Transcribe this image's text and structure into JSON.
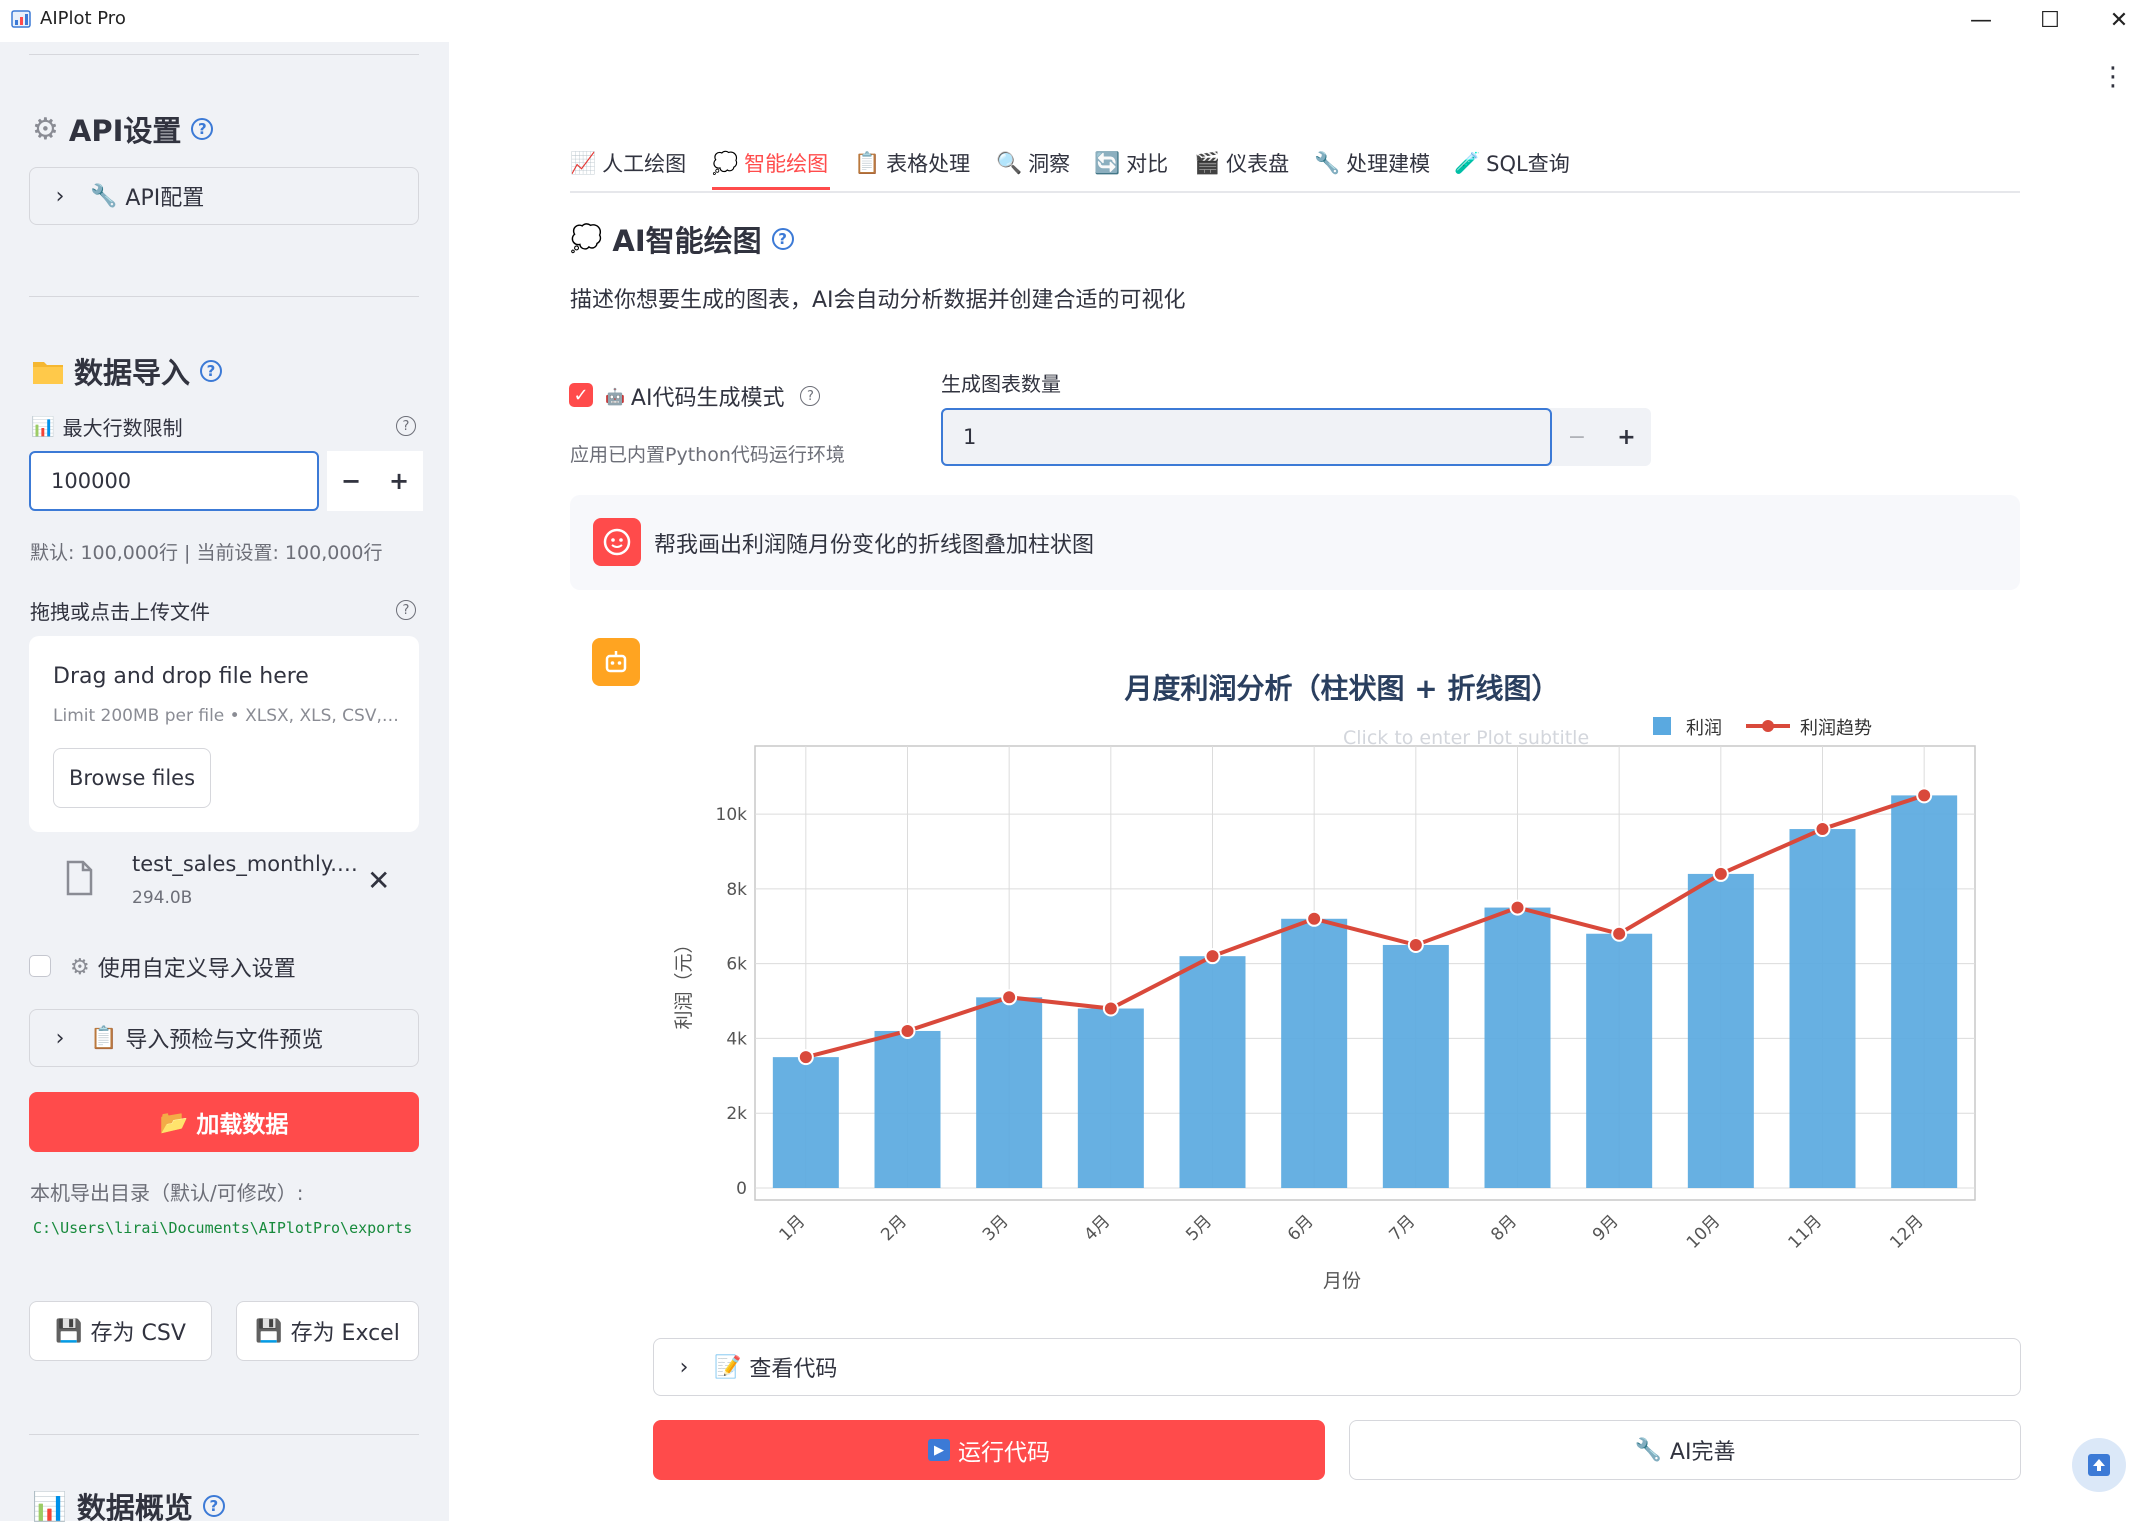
{
  "window": {
    "title": "AIPlot Pro",
    "minimize": "—",
    "maximize": "☐",
    "close": "✕"
  },
  "sidebar": {
    "api_heading": "API设置",
    "api_config": "API配置",
    "data_import_heading": "数据导入",
    "max_rows_label": "最大行数限制",
    "max_rows_value": "100000",
    "max_rows_note": "默认: 100,000行 | 当前设置: 100,000行",
    "upload_label": "拖拽或点击上传文件",
    "upload_title": "Drag and drop file here",
    "upload_limit": "Limit 200MB per file • XLSX, XLS, CSV,…",
    "browse_button": "Browse files",
    "file_name": "test_sales_monthly.…",
    "file_size": "294.0B",
    "custom_import_label": "使用自定义导入设置",
    "preview_expander": "导入预检与文件预览",
    "load_button": "加载数据",
    "export_dir_label": "本机导出目录（默认/可修改）:",
    "export_dir_path": "C:\\Users\\lirai\\Documents\\AIPlotPro\\exports",
    "save_csv": "存为 CSV",
    "save_excel": "存为 Excel",
    "overview_heading": "数据概览"
  },
  "tabs": [
    {
      "label": "人工绘图",
      "icon": "chart-icon"
    },
    {
      "label": "智能绘图",
      "icon": "speech-bubble-icon"
    },
    {
      "label": "表格处理",
      "icon": "clipboard-icon"
    },
    {
      "label": "洞察",
      "icon": "magnifier-icon"
    },
    {
      "label": "对比",
      "icon": "refresh-icon"
    },
    {
      "label": "仪表盘",
      "icon": "clapper-icon"
    },
    {
      "label": "处理建模",
      "icon": "wrench-icon"
    },
    {
      "label": "SQL查询",
      "icon": "test-tube-icon"
    }
  ],
  "active_tab": "智能绘图",
  "main": {
    "heading": "AI智能绘图",
    "description": "描述你想要生成的图表，AI会自动分析数据并创建合适的可视化",
    "ai_code_mode_label": "AI代码生成模式",
    "ai_code_mode_note": "应用已内置Python代码运行环境",
    "chart_count_label": "生成图表数量",
    "chart_count_value": "1",
    "user_prompt": "帮我画出利润随月份变化的折线图叠加柱状图",
    "view_code": "查看代码",
    "run_code": "运行代码",
    "ai_refine": "AI完善"
  },
  "colors": {
    "accent": "#ff4b4b",
    "bar": "#5aa9e0",
    "line": "#d9493b",
    "link": "#3c7ad6",
    "bot_avatar": "#ffa421"
  },
  "chart_data": {
    "type": "bar",
    "title": "月度利润分析（柱状图 + 折线图）",
    "subtitle_placeholder": "Click to enter Plot subtitle",
    "xlabel": "月份",
    "ylabel": "利润（元）",
    "categories": [
      "1月",
      "2月",
      "3月",
      "4月",
      "5月",
      "6月",
      "7月",
      "8月",
      "9月",
      "10月",
      "11月",
      "12月"
    ],
    "series": [
      {
        "name": "利润",
        "type": "bar",
        "values": [
          3500,
          4200,
          5100,
          4800,
          6200,
          7200,
          6500,
          7500,
          6800,
          8400,
          9600,
          10500
        ]
      },
      {
        "name": "利润趋势",
        "type": "line",
        "values": [
          3500,
          4200,
          5100,
          4800,
          6200,
          7200,
          6500,
          7500,
          6800,
          8400,
          9600,
          10500
        ]
      }
    ],
    "y_ticks": [
      "0",
      "2k",
      "4k",
      "6k",
      "8k",
      "10k"
    ],
    "ylim": [
      0,
      11500
    ],
    "grid": true,
    "legend": "top-right"
  }
}
